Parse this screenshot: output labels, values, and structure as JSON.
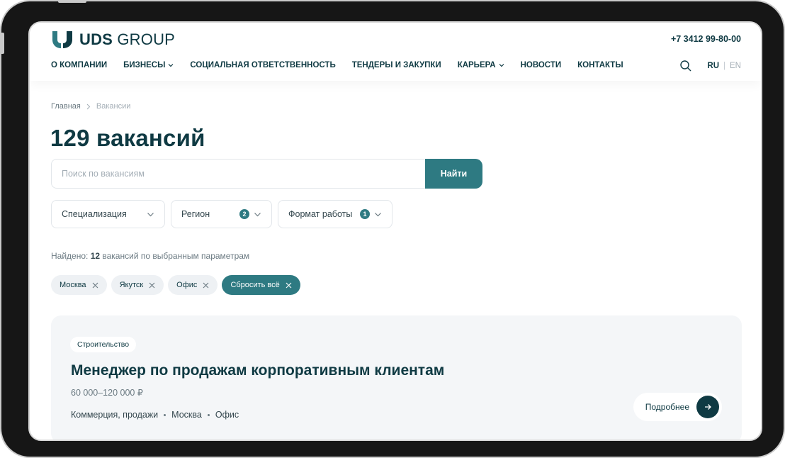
{
  "brand": {
    "logo_bold": "UDS",
    "logo_light": " GROUP",
    "accent": "#2e7a82",
    "dark": "#0f3a43"
  },
  "header": {
    "phone": "+7 3412 99-80-00",
    "nav": [
      {
        "label": "О КОМПАНИИ",
        "has_dropdown": false
      },
      {
        "label": "БИЗНЕСЫ",
        "has_dropdown": true
      },
      {
        "label": "СОЦИАЛЬНАЯ ОТВЕТСТВЕННОСТЬ",
        "has_dropdown": false
      },
      {
        "label": "ТЕНДЕРЫ И ЗАКУПКИ",
        "has_dropdown": false
      },
      {
        "label": "КАРЬЕРА",
        "has_dropdown": true
      },
      {
        "label": "НОВОСТИ",
        "has_dropdown": false
      },
      {
        "label": "КОНТАКТЫ",
        "has_dropdown": false
      }
    ],
    "lang_active": "RU",
    "lang_separator": "|",
    "lang_other": "EN",
    "search_icon": "search-icon"
  },
  "breadcrumb": {
    "home": "Главная",
    "separator": ">",
    "current": "Вакансии"
  },
  "page_title": "129 вакансий",
  "search": {
    "placeholder": "Поиск по вакансиям",
    "value": "",
    "button": "Найти"
  },
  "filters": {
    "specialization": {
      "label": "Специализация",
      "count": ""
    },
    "region": {
      "label": "Регион",
      "count": "2"
    },
    "format": {
      "label": "Формат работы",
      "count": "1"
    }
  },
  "results": {
    "prefix": "Найдено: ",
    "count": "12",
    "suffix": " вакансий по выбранным параметрам"
  },
  "chips": {
    "items": [
      "Москва",
      "Якутск",
      "Офис"
    ],
    "reset": "Сбросить всё"
  },
  "vacancy": {
    "tag": "Строительство",
    "title": "Менеджер по продажам корпоративным клиентам",
    "salary": "60 000–120 000 ₽",
    "meta": [
      "Коммерция, продажи",
      "Москва",
      "Офис"
    ],
    "more": "Подробнее"
  }
}
